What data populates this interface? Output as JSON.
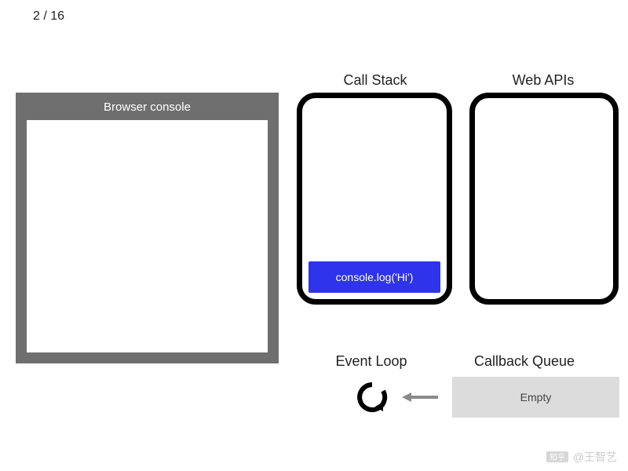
{
  "page_counter": "2 / 16",
  "browser_console": {
    "title": "Browser console"
  },
  "labels": {
    "call_stack": "Call Stack",
    "web_apis": "Web APIs",
    "event_loop": "Event Loop",
    "callback_queue": "Callback Queue"
  },
  "call_stack": {
    "frames": [
      {
        "label": "console.log('Hi')"
      }
    ]
  },
  "callback_queue": {
    "status": "Empty"
  },
  "icons": {
    "event_loop": "event-loop-circular-arrow-icon",
    "arrow_left": "arrow-left-icon"
  },
  "colors": {
    "frame_bg": "#2f33e9",
    "console_frame": "#6f6f6f",
    "queue_bg": "#dcdcdc"
  },
  "watermark": {
    "brand": "知乎",
    "user": "@王智艺"
  }
}
